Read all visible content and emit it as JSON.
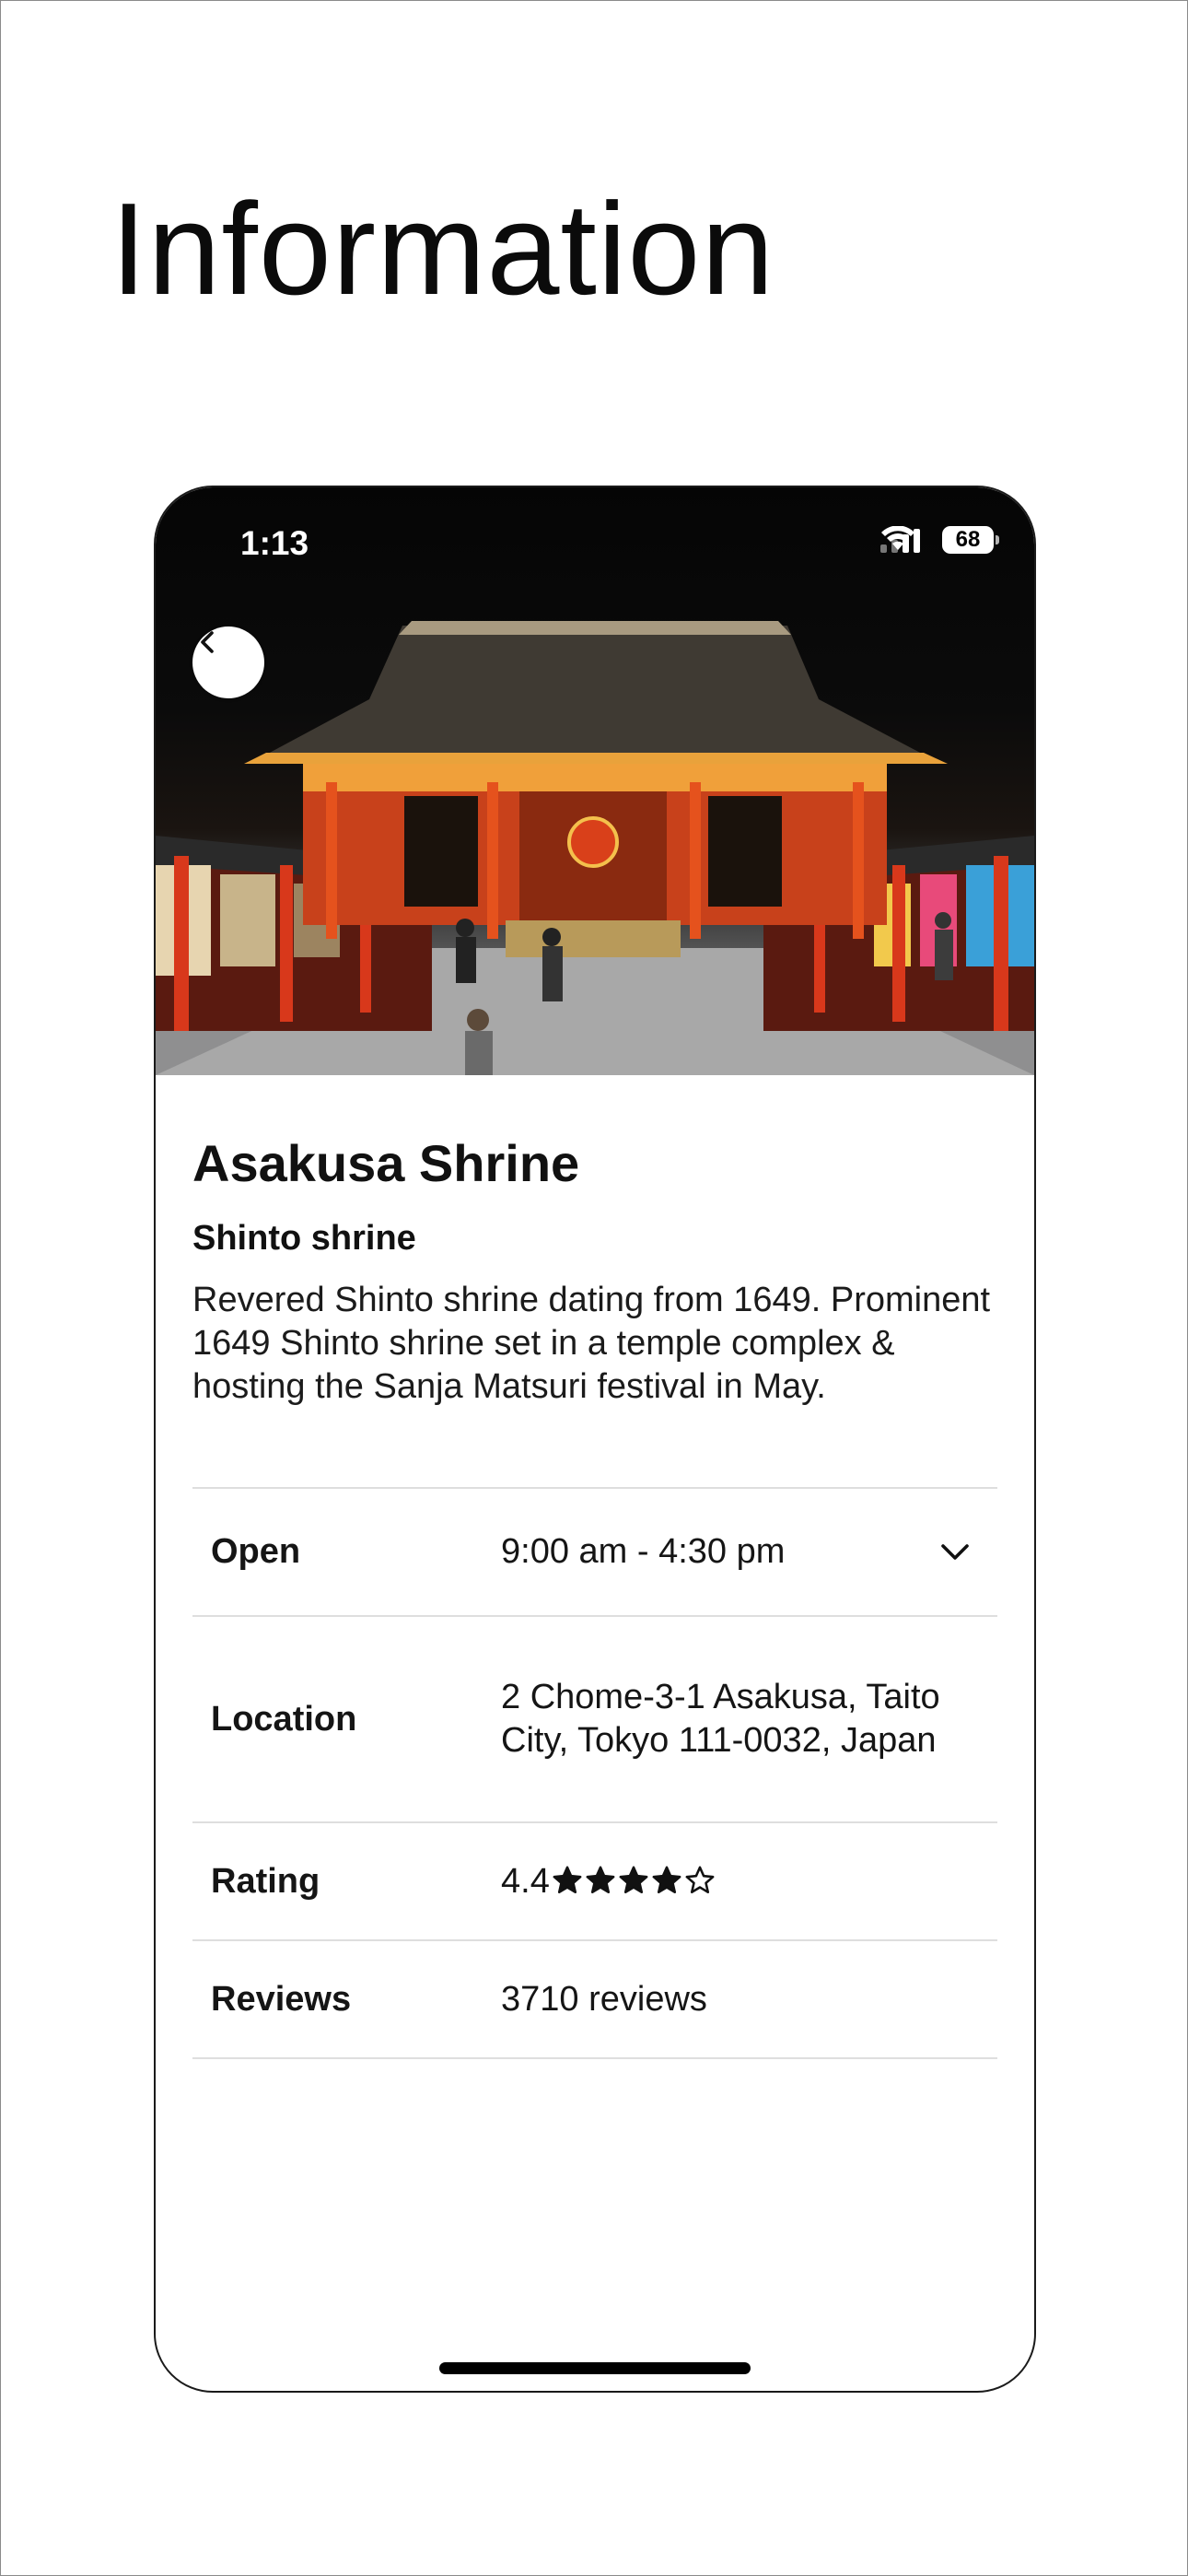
{
  "page": {
    "title": "Information"
  },
  "status_bar": {
    "time": "1:13",
    "battery": "68"
  },
  "place": {
    "name": "Asakusa Shrine",
    "type": "Shinto shrine",
    "description": "Revered Shinto shrine dating from 1649. Prominent 1649 Shinto shrine set in a temple complex & hosting the Sanja Matsuri festival in May."
  },
  "details": {
    "open": {
      "label": "Open",
      "value": "9:00 am - 4:30 pm"
    },
    "location": {
      "label": "Location",
      "value": "2 Chome-3-1 Asakusa, Taito City, Tokyo 111-0032, Japan"
    },
    "rating": {
      "label": "Rating",
      "value": "4.4",
      "stars_filled": 4,
      "stars_total": 5
    },
    "reviews": {
      "label": "Reviews",
      "value": "3710 reviews"
    }
  },
  "icons": {
    "back": "chevron-left-icon",
    "expand": "chevron-down-icon",
    "star": "star-icon"
  },
  "colors": {
    "accent": "#000000",
    "divider": "#dedede",
    "hero_lantern": "#d9401a"
  }
}
